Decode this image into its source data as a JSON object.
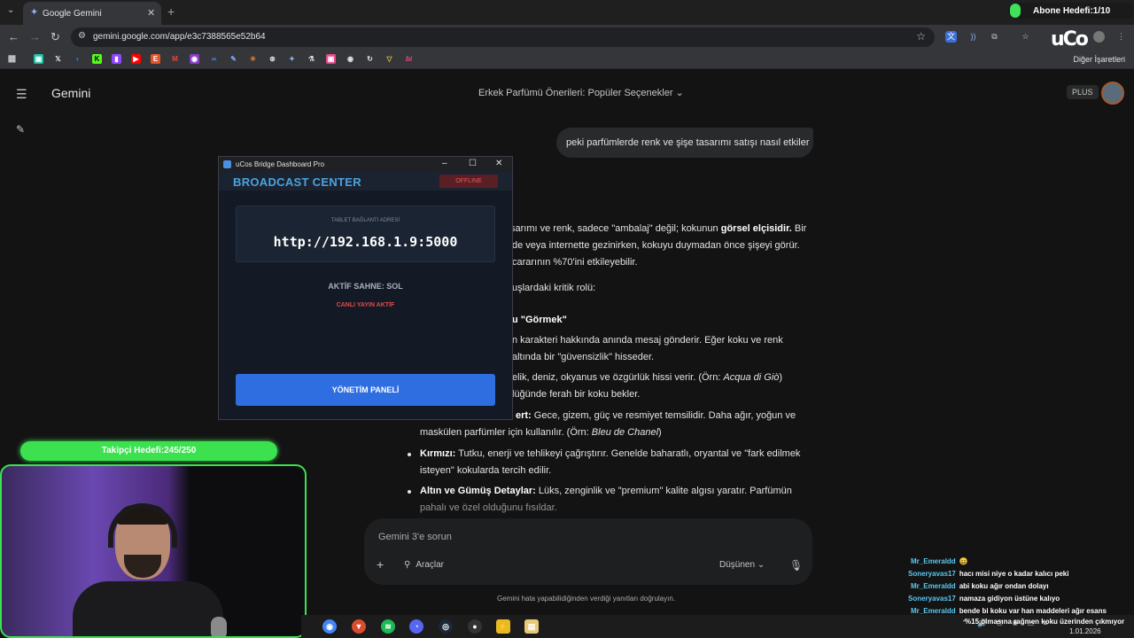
{
  "browser": {
    "tab_title": "Google Gemini",
    "url": "gemini.google.com/app/e3c7388565e52b64",
    "bookmarks_other": "Diğer İşaretleri"
  },
  "stream": {
    "abone_hedefi": "Abone Hedefi:1/10",
    "takipci_hedefi": "Takipçi Hedefi:245/250",
    "date": "1.01.2026"
  },
  "gemini": {
    "app_title": "Gemini",
    "conversation_title": "Erkek Parfümü Önerileri: Popüler Seçenekler",
    "plan_badge": "PLUS",
    "user_message": "peki parfümlerde renk ve şişe tasarımı satışı nasıl etkiler",
    "response": {
      "p1_a": "sarımı ve renk, sadece \"ambalaj\" değil; kokunun",
      "p1_b": "görsel elçisidir.",
      "p1_c": "Bir",
      "p1_line2": "de veya internette gezinirken, kokuyu duymadan önce şişeyi görür.",
      "p1_line3": "cararının %70'ini etkileyebilir.",
      "p2": "uşlardaki kritik rolü:",
      "h1": "u \"Görmek\"",
      "l1a": "n karakteri hakkında anında mesaj gönderir. Eğer koku ve renk",
      "l1b": "altında bir \"güvensizlik\" hisseder.",
      "l2a_pre": "elik, deniz, okyanus ve özgürlük hissi verir. (Örn: ",
      "l2a_it": "Acqua di Giò",
      "l2a_post": ")",
      "l2b": "lüğünde ferah bir koku bekler.",
      "b3_label": "ert:",
      "b3_text": "Gece, gizem, güç ve resmiyet temsilidir. Daha ağır, yoğun ve",
      "b3_line2_pre": "maskülen parfümler için kullanılır. (Örn: ",
      "b3_line2_it": "Bleu de Chanel",
      "b3_line2_post": ")",
      "b4_label": "Kırmızı:",
      "b4_text": "Tutku, enerji ve tehlikeyi çağrıştırır. Genelde baharatlı, oryantal ve \"fark edilmek",
      "b4_line2": "isteyen\" kokularda tercih edilir.",
      "b5_label": "Altın ve Gümüş Detaylar:",
      "b5_text": "Lüks, zenginlik ve \"premium\" kalite algısı yaratır. Parfümün",
      "b5_line2": "pahalı ve özel olduğunu fısıldar."
    },
    "input_placeholder": "Gemini 3'e sorun",
    "tools_label": "Araçlar",
    "model_label": "Düşünen",
    "disclaimer": "Gemini hata yapabilidiğinden verdiği yanıtları doğrulayın."
  },
  "ucos": {
    "window_title": "uCos Bridge Dashboard Pro",
    "header_title": "BROADCAST CENTER",
    "status": "OFFLINE",
    "url_label": "TABLET BAĞLANTI ADRESİ",
    "url_value": "http://192.168.1.9:5000",
    "scene": "AKTİF SAHNE: SOL",
    "live": "CANLI YAYIN AKTİF",
    "button": "YÖNETİM PANELİ"
  },
  "chat": [
    {
      "user": "Mr_Emeraldd",
      "msg": "😄"
    },
    {
      "user": "Soneryavas17",
      "msg": "hacı misi niye o kadar kalıcı peki"
    },
    {
      "user": "Mr_Emeraldd",
      "msg": "abi koku ağır ondan dolayı"
    },
    {
      "user": "Soneryavas17",
      "msg": "namaza gidiyon üstüne kalıyo"
    },
    {
      "user": "Mr_Emeraldd",
      "msg": "bende bi koku var han maddeleri ağır esans"
    },
    {
      "user": "",
      "msg": "%15 olmasına rağmen koku üzerinden çıkmıyor"
    }
  ],
  "colors": {
    "bg": "#131314",
    "accent_green": "#3be14f",
    "ucos_blue": "#4aa3df",
    "button_blue": "#2f6ee0",
    "offline_red": "#e85a5a"
  }
}
